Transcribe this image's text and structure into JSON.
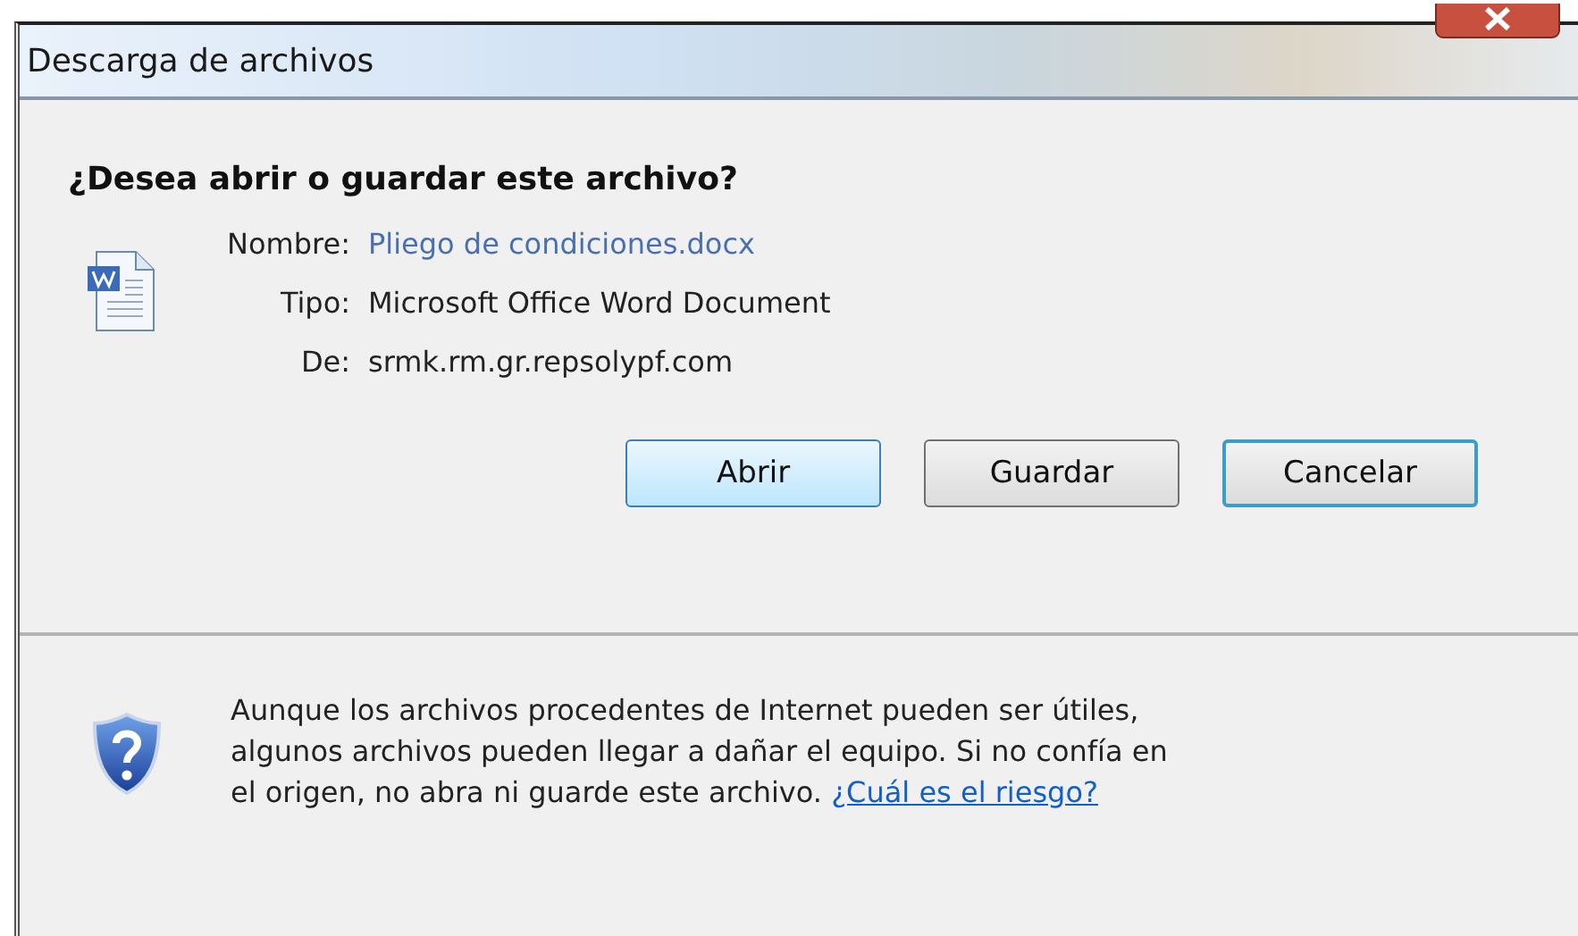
{
  "window": {
    "title": "Descarga de archivos"
  },
  "heading": "¿Desea abrir o guardar este archivo?",
  "file_info": [
    {
      "label": "Nombre:",
      "value": "Pliego de condiciones.docx",
      "kind": "link"
    },
    {
      "label": "Tipo:",
      "value": "Microsoft Office Word Document",
      "kind": "text"
    },
    {
      "label": "De:",
      "value": "srmk.rm.gr.repsolypf.com",
      "kind": "text"
    }
  ],
  "buttons": [
    {
      "label": "Abrir",
      "highlighted": true,
      "focused": false
    },
    {
      "label": "Guardar",
      "highlighted": false,
      "focused": false
    },
    {
      "label": "Cancelar",
      "highlighted": false,
      "focused": true
    }
  ],
  "warning": {
    "lines": [
      "Aunque los archivos procedentes de Internet pueden ser útiles,",
      "algunos archivos pueden llegar a dañar el equipo. Si no confía en",
      "el origen, no abra ni guarde este archivo."
    ],
    "link": "¿Cuál es el riesgo?"
  }
}
